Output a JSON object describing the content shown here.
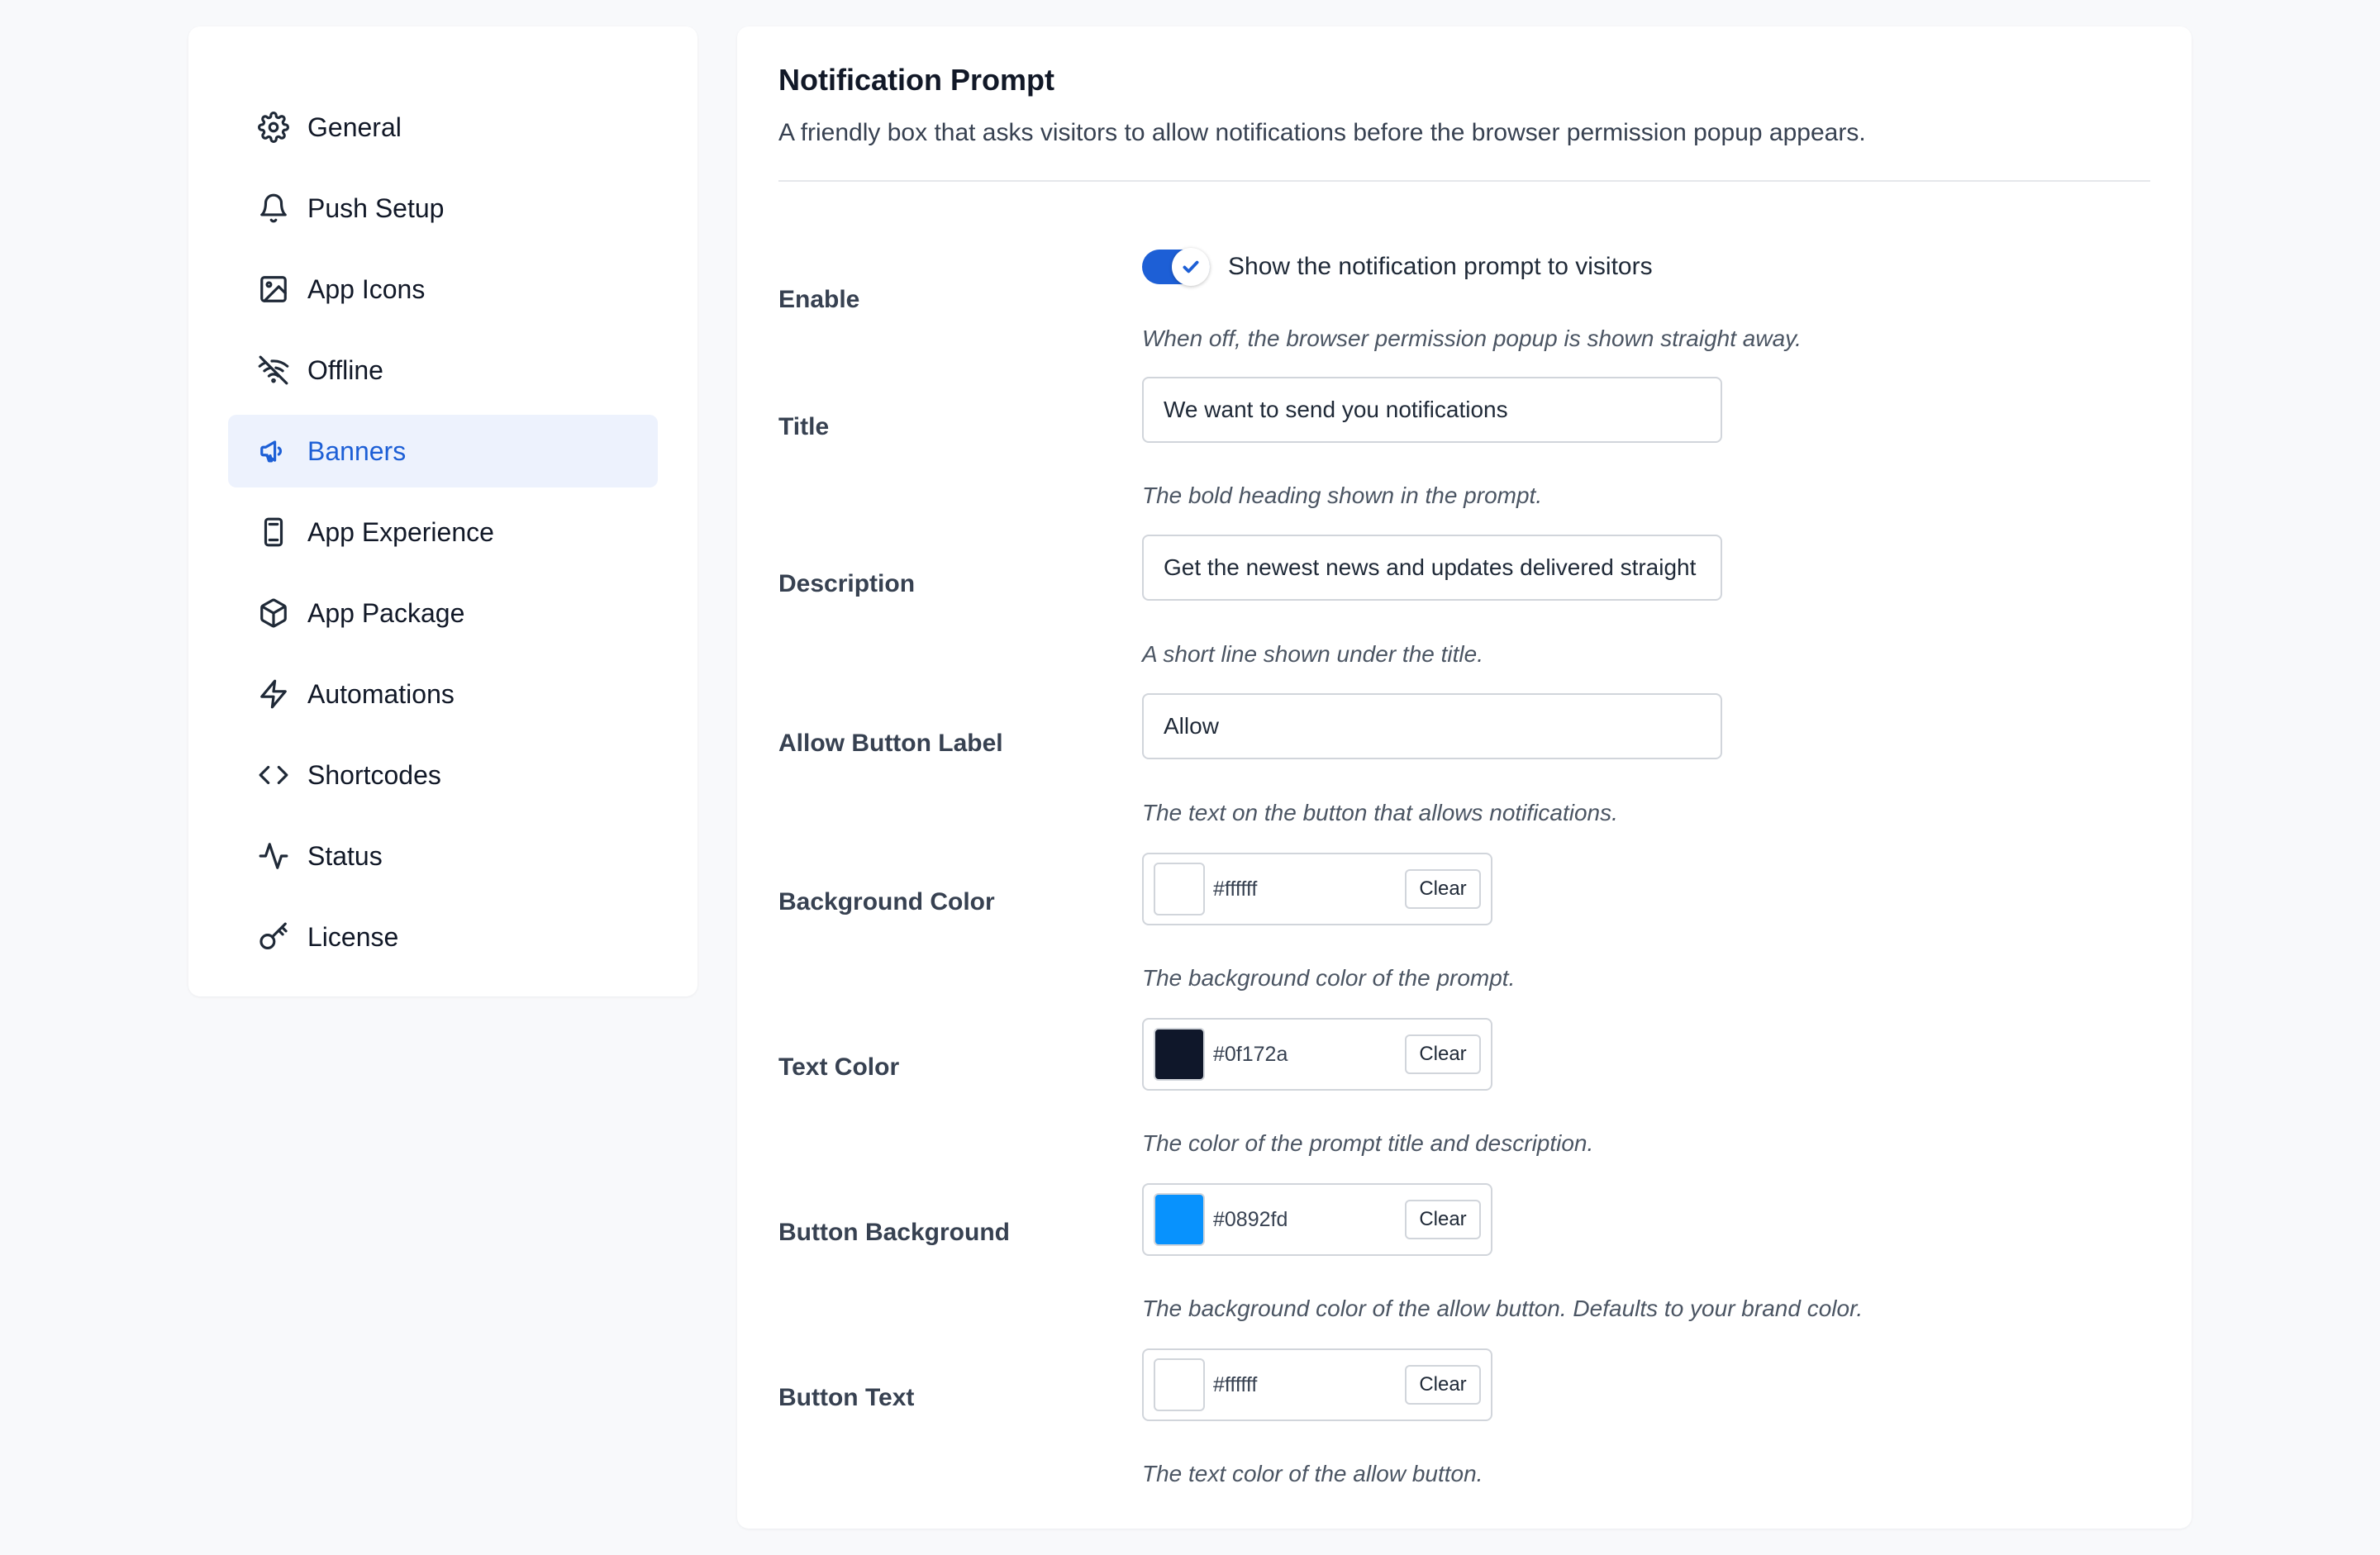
{
  "sidebar": {
    "items": [
      {
        "label": "General",
        "icon": "gear-icon"
      },
      {
        "label": "Push Setup",
        "icon": "bell-icon"
      },
      {
        "label": "App Icons",
        "icon": "image-icon"
      },
      {
        "label": "Offline",
        "icon": "wifi-off-icon"
      },
      {
        "label": "Banners",
        "icon": "megaphone-icon",
        "active": true
      },
      {
        "label": "App Experience",
        "icon": "mobile-icon"
      },
      {
        "label": "App Package",
        "icon": "box-icon"
      },
      {
        "label": "Automations",
        "icon": "lightning-icon"
      },
      {
        "label": "Shortcodes",
        "icon": "code-icon"
      },
      {
        "label": "Status",
        "icon": "activity-icon"
      },
      {
        "label": "License",
        "icon": "key-icon"
      }
    ]
  },
  "panel": {
    "title": "Notification Prompt",
    "description": "A friendly box that asks visitors to allow notifications before the browser permission popup appears.",
    "enable": {
      "label": "Enable",
      "checked": true,
      "toggle_text": "Show the notification prompt to visitors",
      "help": "When off, the browser permission popup is shown straight away."
    },
    "title_field": {
      "label": "Title",
      "value": "We want to send you notifications",
      "help": "The bold heading shown in the prompt."
    },
    "description_field": {
      "label": "Description",
      "value": "Get the newest news and updates delivered straight to you.",
      "help": "A short line shown under the title."
    },
    "allow_button_label": {
      "label": "Allow Button Label",
      "value": "Allow",
      "help": "The text on the button that allows notifications."
    },
    "background_color": {
      "label": "Background Color",
      "value": "#ffffff",
      "swatch": "#ffffff",
      "clear": "Clear",
      "help": "The background color of the prompt."
    },
    "text_color": {
      "label": "Text Color",
      "value": "#0f172a",
      "swatch": "#0f172a",
      "clear": "Clear",
      "help": "The color of the prompt title and description."
    },
    "button_background": {
      "label": "Button Background",
      "value": "#0892fd",
      "swatch": "#0892fd",
      "clear": "Clear",
      "help": "The background color of the allow button. Defaults to your brand color."
    },
    "button_text": {
      "label": "Button Text",
      "value": "#ffffff",
      "swatch": "#ffffff",
      "clear": "Clear",
      "help": "The text color of the allow button."
    }
  },
  "colors": {
    "accent": "#1d5fd6",
    "active_bg": "#edf2fd",
    "page_bg": "#f8f9fb"
  }
}
